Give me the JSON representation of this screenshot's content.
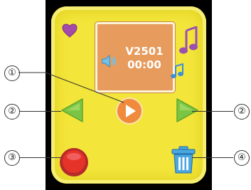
{
  "display": {
    "title": "V2501",
    "time": "00:00"
  },
  "callouts": {
    "c1": "①",
    "c2a": "②",
    "c2b": "②",
    "c3": "③",
    "c4": "④"
  },
  "colors": {
    "screen": "#f3e53a",
    "display": "#e79b5c",
    "play": "#f08a3c",
    "arrow": "#7cc544",
    "record": "#e5332a",
    "trash": "#4aa7e0"
  },
  "icons": [
    "heart-icon",
    "music-note-icon",
    "speaker-icon",
    "play-icon",
    "prev-arrow-icon",
    "next-arrow-icon",
    "record-icon",
    "trash-icon"
  ]
}
